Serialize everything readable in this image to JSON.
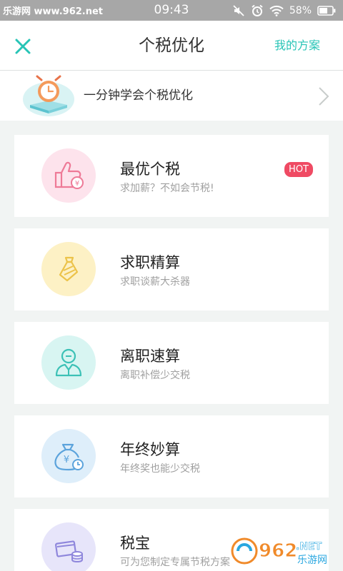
{
  "status_bar": {
    "site_label": "乐游网 www.962.net",
    "time": "09:43",
    "battery": "58%"
  },
  "nav": {
    "title": "个税优化",
    "right_link": "我的方案",
    "accent_color": "#27c4b6"
  },
  "banner": {
    "text": "一分钟学会个税优化"
  },
  "cards": [
    {
      "title": "最优个税",
      "subtitle": "求加薪？不如会节税!",
      "badge": "HOT",
      "icon": "thumbs-up-icon",
      "circle_color": "#fde3ec",
      "icon_color": "#ee7a97"
    },
    {
      "title": "求职精算",
      "subtitle": "求职谈薪大杀器",
      "icon": "tie-icon",
      "circle_color": "#fdf1c5",
      "icon_color": "#ecc34a"
    },
    {
      "title": "离职速算",
      "subtitle": "离职补偿少交税",
      "icon": "person-icon",
      "circle_color": "#d8f5f2",
      "icon_color": "#3cc1b6"
    },
    {
      "title": "年终妙算",
      "subtitle": "年终奖也能少交税",
      "icon": "money-bag-icon",
      "circle_color": "#deeefa",
      "icon_color": "#5ba3dc"
    },
    {
      "title": "税宝",
      "subtitle": "可为您制定专属节税方案",
      "icon": "wallet-icon",
      "circle_color": "#e7e5fa",
      "icon_color": "#8f87dc"
    }
  ],
  "watermark": {
    "text": "962",
    "suffix": ".NET",
    "label": "乐游网"
  }
}
